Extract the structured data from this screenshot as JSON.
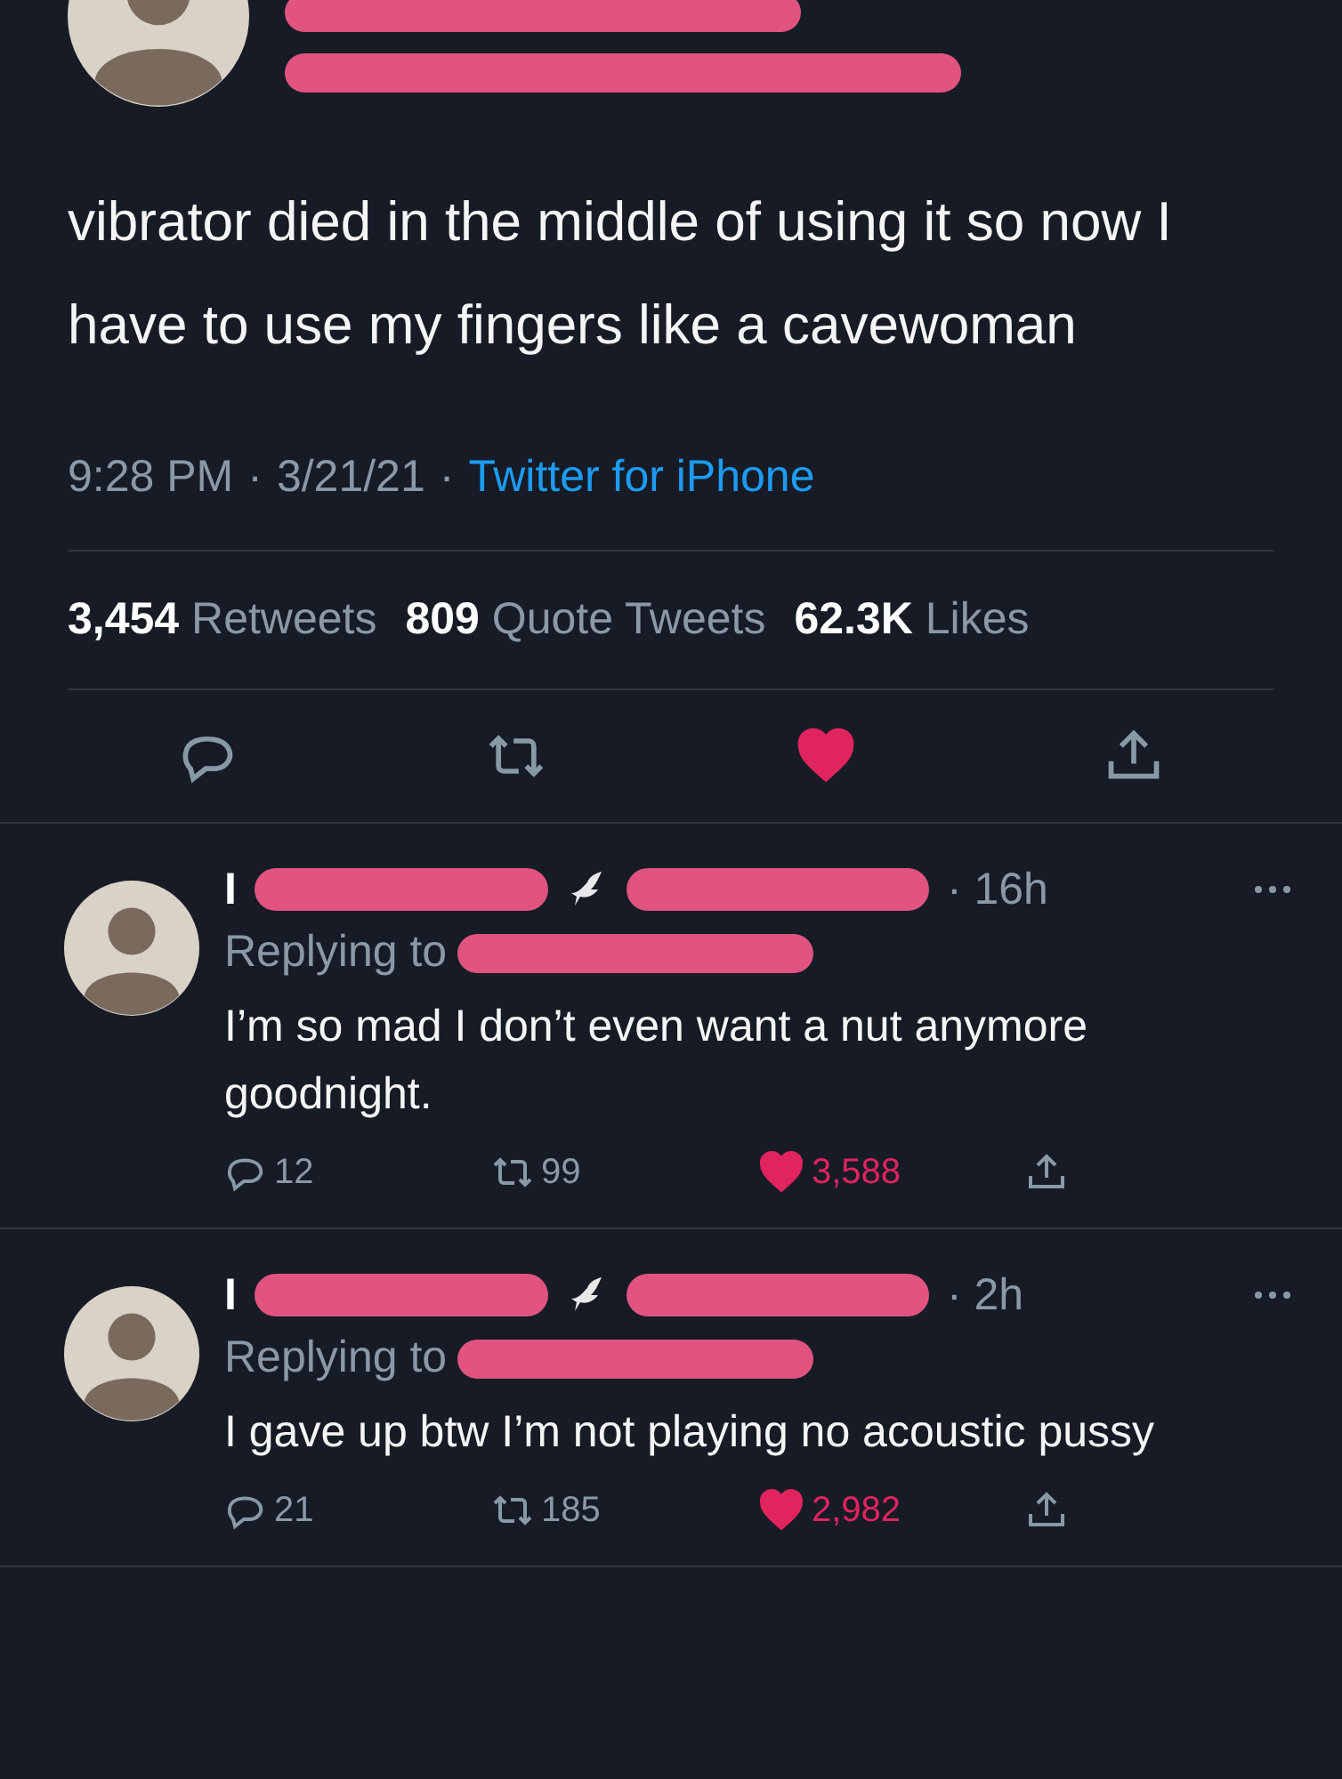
{
  "tweet": {
    "text": "vibrator died in the middle of using it so now I have to use my fingers like a cavewoman",
    "time": "9:28 PM",
    "date": "3/21/21",
    "separator": "·",
    "source": "Twitter for iPhone",
    "stats": [
      {
        "count": "3,454",
        "label": "Retweets"
      },
      {
        "count": "809",
        "label": "Quote Tweets"
      },
      {
        "count": "62.3K",
        "label": "Likes"
      }
    ],
    "liked": true
  },
  "replies": [
    {
      "name_start": "I",
      "age": "· 16h",
      "replying_to": "Replying to",
      "text": "I’m so mad I don’t even want a nut anymore goodnight.",
      "replies": "12",
      "retweets": "99",
      "likes": "3,588",
      "liked": true
    },
    {
      "name_start": "I",
      "age": "· 2h",
      "replying_to": "Replying to",
      "text": "I gave up btw I’m not playing no acoustic pussy",
      "replies": "21",
      "retweets": "185",
      "likes": "2,982",
      "liked": true
    }
  ]
}
